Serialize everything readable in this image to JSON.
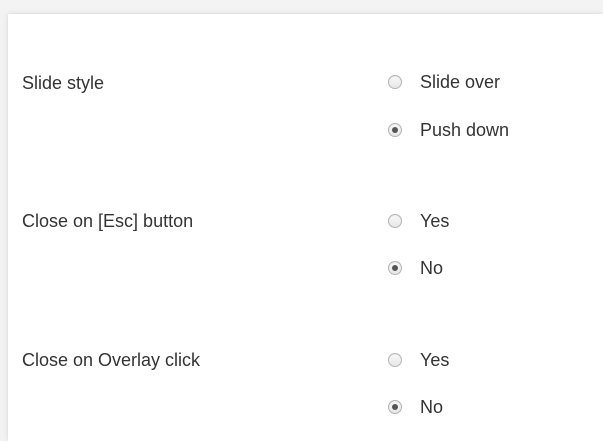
{
  "settings": [
    {
      "label": "Slide style",
      "options": [
        {
          "label": "Slide over",
          "checked": false
        },
        {
          "label": "Push down",
          "checked": true
        }
      ]
    },
    {
      "label": "Close on [Esc] button",
      "options": [
        {
          "label": "Yes",
          "checked": false
        },
        {
          "label": "No",
          "checked": true
        }
      ]
    },
    {
      "label": "Close on Overlay click",
      "options": [
        {
          "label": "Yes",
          "checked": false
        },
        {
          "label": "No",
          "checked": true
        }
      ]
    }
  ]
}
